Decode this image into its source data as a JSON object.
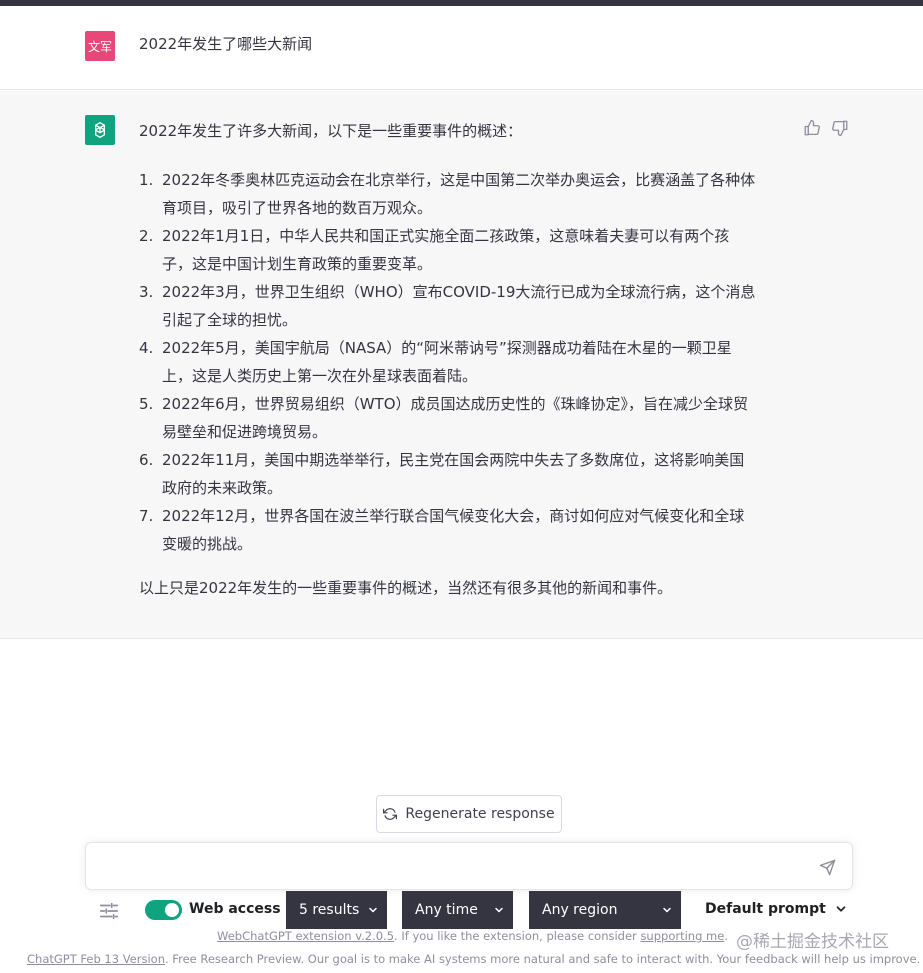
{
  "user_message": {
    "avatar_text": "文军",
    "text": "2022年发生了哪些大新闻"
  },
  "assistant_message": {
    "intro": "2022年发生了许多大新闻，以下是一些重要事件的概述：",
    "items": [
      {
        "num": "1.",
        "lines": [
          "2022年冬季奥林匹克运动会在北京举行，这是中国第二次举办奥运会，比赛涵盖了各种体",
          "育项目，吸引了世界各地的数百万观众。"
        ]
      },
      {
        "num": "2.",
        "lines": [
          "2022年1月1日，中华人民共和国正式实施全面二孩政策，这意味着夫妻可以有两个孩",
          "子，这是中国计划生育政策的重要变革。"
        ]
      },
      {
        "num": "3.",
        "lines": [
          "2022年3月，世界卫生组织（WHO）宣布COVID-19大流行已成为全球流行病，这个消息",
          "引起了全球的担忧。"
        ]
      },
      {
        "num": "4.",
        "lines": [
          "2022年5月，美国宇航局（NASA）的“阿米蒂讷号”探测器成功着陆在木星的一颗卫星",
          "上，这是人类历史上第一次在外星球表面着陆。"
        ]
      },
      {
        "num": "5.",
        "lines": [
          "2022年6月，世界贸易组织（WTO）成员国达成历史性的《珠峰协定》，旨在减少全球贸",
          "易壁垒和促进跨境贸易。"
        ]
      },
      {
        "num": "6.",
        "lines": [
          "2022年11月，美国中期选举举行，民主党在国会两院中失去了多数席位，这将影响美国",
          "政府的未来政策。"
        ]
      },
      {
        "num": "7.",
        "lines": [
          "2022年12月，世界各国在波兰举行联合国气候变化大会，商讨如何应对气候变化和全球",
          "变暖的挑战。"
        ]
      }
    ],
    "outro": "以上只是2022年发生的一些重要事件的概述，当然还有很多其他的新闻和事件。"
  },
  "regenerate_label": "Regenerate response",
  "input": {
    "placeholder": "",
    "value": ""
  },
  "toolbar": {
    "web_access_label": "Web access",
    "web_access_on": true,
    "results_select": "5 results",
    "time_select": "Any time",
    "region_select": "Any region",
    "prompt_select": "Default prompt"
  },
  "ext_footer": {
    "link1": "WebChatGPT extension v.2.0.5",
    "middle": ". If you like the extension, please consider ",
    "link2": "supporting me",
    "end": "."
  },
  "watermark": "@稀土掘金技术社区",
  "footer": {
    "link": "ChatGPT Feb 13 Version",
    "text": ". Free Research Preview. Our goal is to make AI systems more natural and safe to interact with. Your feedback will help us improve."
  },
  "colors": {
    "accent": "#10a37f",
    "user_avatar": "#e8477a",
    "select_bg": "#343541",
    "assistant_bg": "#f7f7f8"
  }
}
